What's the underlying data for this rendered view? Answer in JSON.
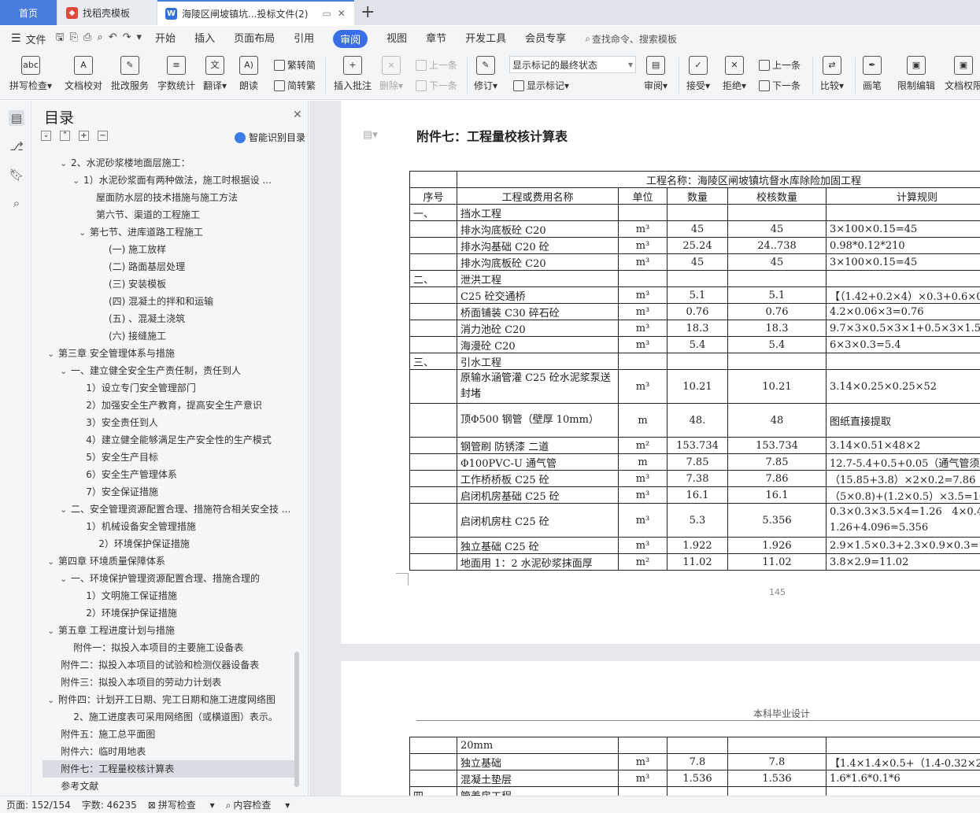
{
  "tabs": {
    "home": "首页",
    "t2": "找稻壳模板",
    "t3": "海陵区闸坡镇坑...投标文件(2)"
  },
  "menu": {
    "file": "文件",
    "items": [
      "开始",
      "插入",
      "页面布局",
      "引用",
      "审阅",
      "视图",
      "章节",
      "开发工具",
      "会员专享"
    ],
    "active": "审阅",
    "search": "查找命令、搜索模板"
  },
  "ribbon": {
    "spell": "拼写检查",
    "proof": "文档校对",
    "batch": "批改服务",
    "wordcount": "字数统计",
    "translate": "翻译",
    "read": "朗读",
    "trad": "繁转简",
    "simp": "简转繁",
    "comment": "插入批注",
    "del": "删除",
    "prev": "上一条",
    "next": "下一条",
    "revise": "修订",
    "markup_state": "显示标记的最终状态",
    "show_markup": "显示标记",
    "review": "审阅",
    "accept": "接受",
    "reject": "拒绝",
    "prev2": "上一条",
    "next2": "下一条",
    "compare": "比较",
    "pen": "画笔",
    "restrict": "限制编辑",
    "docperm": "文档权限"
  },
  "toc": {
    "title": "目录",
    "smart": "智能识别目录",
    "items": [
      {
        "t": "2、水泥砂浆楼地面层施工：",
        "l": 2,
        "a": true
      },
      {
        "t": "1）水泥砂浆面有两种做法，施工时根据设 ...",
        "l": 3,
        "a": true
      },
      {
        "t": "屋面防水层的技术措施与施工方法",
        "l": 4
      },
      {
        "t": "第六节、渠道的工程施工",
        "l": 4
      },
      {
        "t": "第七节、进库道路工程施工",
        "l": 3.5,
        "a": true
      },
      {
        "t": "(一) 施工放样",
        "l": 5
      },
      {
        "t": "(二) 路面基层处理",
        "l": 5
      },
      {
        "t": "(三) 安装模板",
        "l": 5
      },
      {
        "t": "(四) 混凝土的拌和和运输",
        "l": 5
      },
      {
        "t": "(五) 、混凝土浇筑",
        "l": 5
      },
      {
        "t": "(六) 接缝施工",
        "l": 5
      },
      {
        "t": "第三章 安全管理体系与措施",
        "l": 1,
        "a": true
      },
      {
        "t": "一、建立健全安全生产责任制，责任到人",
        "l": 2,
        "a": true
      },
      {
        "t": "1）设立专门安全管理部门",
        "l": 3.2
      },
      {
        "t": "2）加强安全生产教育，提高安全生产意识",
        "l": 3.2
      },
      {
        "t": "3）安全责任到人",
        "l": 3.2
      },
      {
        "t": "4）建立健全能够满足生产安全性的生产模式",
        "l": 3.2
      },
      {
        "t": "5）安全生产目标",
        "l": 3.2
      },
      {
        "t": "6）安全生产管理体系",
        "l": 3.2
      },
      {
        "t": "7）安全保证措施",
        "l": 3.2
      },
      {
        "t": "二、安全管理资源配置合理、措施符合相关安全技 ...",
        "l": 2,
        "a": true
      },
      {
        "t": "1）机械设备安全管理措施",
        "l": 3.2
      },
      {
        "t": "2）环境保护保证措施",
        "l": 4.2
      },
      {
        "t": "第四章 环境质量保障体系",
        "l": 1,
        "a": true
      },
      {
        "t": "一、环境保护管理资源配置合理、措施合理的",
        "l": 2,
        "a": true
      },
      {
        "t": "1）文明施工保证措施",
        "l": 3.2
      },
      {
        "t": "2）环境保护保证措施",
        "l": 3.2
      },
      {
        "t": "第五章 工程进度计划与措施",
        "l": 1,
        "a": true
      },
      {
        "t": "附件一：拟投入本项目的主要施工设备表",
        "l": 2.2
      },
      {
        "t": "附件二：拟投入本项目的试验和检测仪器设备表",
        "l": 1.2
      },
      {
        "t": "附件三：拟投入本项目的劳动力计划表",
        "l": 1.2
      },
      {
        "t": "附件四：计划开工日期、完工日期和施工进度网络图",
        "l": 1,
        "a": true
      },
      {
        "t": "2、施工进度表可采用网络图（或横道图）表示。",
        "l": 2.2
      },
      {
        "t": "附件五：施工总平面图",
        "l": 1.2
      },
      {
        "t": "附件六：临时用地表",
        "l": 1.2
      },
      {
        "t": "附件七：工程量校核计算表",
        "l": 1.2,
        "sel": true
      },
      {
        "t": "参考文献",
        "l": 1.2
      }
    ]
  },
  "doc": {
    "heading": "附件七：工程量校核计算表",
    "project": "工程名称：海陵区闸坡镇坑督水库除险加固工程",
    "headers": [
      "序号",
      "工程或费用名称",
      "单位",
      "数量",
      "校核数量",
      "计算规则"
    ],
    "rows": [
      [
        "一、",
        "挡水工程",
        "",
        "",
        "",
        ""
      ],
      [
        "",
        "排水沟底板砼 C20",
        "m³",
        "45",
        "45",
        "3×100×0.15=45"
      ],
      [
        "",
        "排水沟基础  C20 砼",
        "m³",
        "25.24",
        "24..738",
        "0.98*0.12*210"
      ],
      [
        "",
        "排水沟底板砼 C20",
        "m³",
        "45",
        "45",
        "3×100×0.15=45"
      ],
      [
        "二、",
        "泄洪工程",
        "",
        "",
        "",
        ""
      ],
      [
        "",
        "C25 砼交通桥",
        "m³",
        "5.1",
        "5.1",
        "【（1.42+0.2×4）×0.3+0.6×0"
      ],
      [
        "",
        "桥面铺装 C30 碎石砼",
        "m³",
        "0.76",
        "0.76",
        "4.2×0.06×3=0.76"
      ],
      [
        "",
        "消力池砼 C20",
        "m³",
        "18.3",
        "18.3",
        "9.7×3×0.5×3×1+0.5×3×1.5"
      ],
      [
        "",
        "海漫砼 C20",
        "m³",
        "5.4",
        "5.4",
        "6×3×0.3=5.4"
      ],
      [
        "三、",
        "引水工程",
        "",
        "",
        "",
        ""
      ],
      [
        "",
        "原输水涵管灌 C25 砼水泥浆泵送封堵",
        "m³",
        "10.21",
        "10.21",
        "3.14×0.25×0.25×52"
      ],
      [
        "",
        "顶Φ500 钢管（壁厚 10mm）",
        "m",
        "48.",
        "48",
        "图纸直接提取"
      ],
      [
        "",
        "钢管刷  防锈漆  二道",
        "m²",
        "153.734",
        "153.734",
        "3.14×0.51×48×2"
      ],
      [
        "",
        "Φ100PVC-U 通气管",
        "m",
        "7.85",
        "7.85",
        "12.7-5.4+0.5+0.05（通气管须高"
      ],
      [
        "",
        "工作桥桥板 C25 砼",
        "m³",
        "7.38",
        "7.86",
        "（15.85+3.8）×2×0.2=7.86"
      ],
      [
        "",
        "启闭机房基础 C25 砼",
        "m³",
        "16.1",
        "16.1",
        "（5×0.8)+(1.2×0.5）×3.5=16."
      ],
      [
        "",
        "启闭机房柱 C25 砼",
        "m³",
        "5.3",
        "5.356",
        "0.3×0.3×3.5×4=1.26   4×0.4\n1.26+4.096=5.356"
      ],
      [
        "",
        "独立基础 C25 砼",
        "m³",
        "1.922",
        "1.926",
        "2.9×1.5×0.3+2.3×0.9×0.3=1.9"
      ],
      [
        "",
        "地面用 1：2 水泥砂浆抹面厚",
        "m²",
        "11.02",
        "11.02",
        "3.8×2.9=11.02"
      ]
    ],
    "page_number": "145",
    "header2": "本科毕业设计",
    "rows2": [
      [
        "",
        "20mm",
        "",
        "",
        "",
        ""
      ],
      [
        "",
        "独立基础",
        "m³",
        "7.8",
        "7.8",
        "【1.4×1.4×0.5+（1.4-0.32×2）"
      ],
      [
        "",
        "混凝土垫层",
        "m³",
        "1.536",
        "1.536",
        "1.6*1.6*0.1*6"
      ],
      [
        "四",
        "管养房工程",
        "",
        "",
        "",
        ""
      ]
    ]
  },
  "status": {
    "page": "页面: 152/154",
    "words": "字数: 46235",
    "spell": "拼写检查",
    "content": "内容检查"
  }
}
